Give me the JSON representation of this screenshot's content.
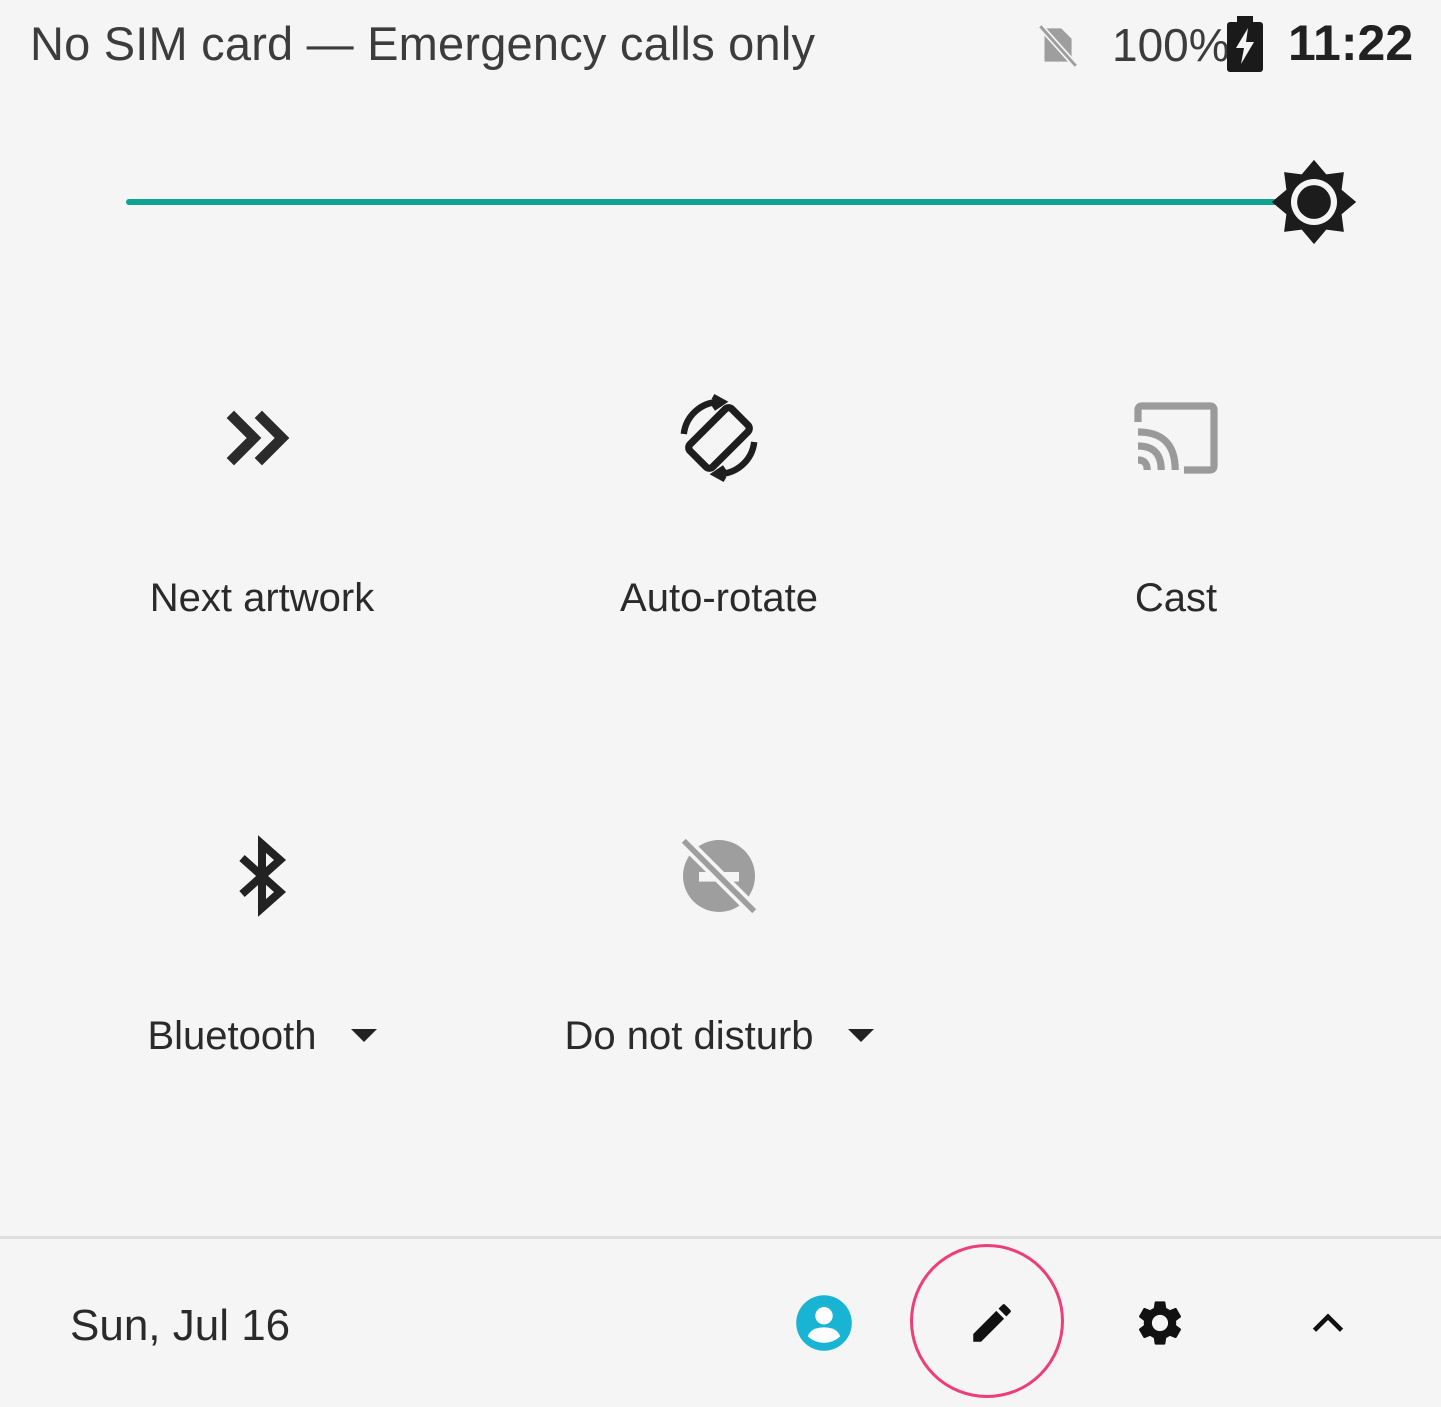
{
  "status_bar": {
    "carrier_text": "No SIM card — Emergency calls only",
    "battery_percent": "100%",
    "time": "11:22",
    "icons": [
      "no-sim-icon",
      "battery-charging-icon"
    ]
  },
  "brightness": {
    "level": 1.0,
    "track_color": "#0fa48f",
    "icon": "brightness-auto-icon"
  },
  "tiles": [
    {
      "label": "Next artwork",
      "icon": "double-chevron-right-icon",
      "has_dropdown": false,
      "state": "active"
    },
    {
      "label": "Auto-rotate",
      "icon": "screen-rotation-icon",
      "has_dropdown": false,
      "state": "active"
    },
    {
      "label": "Cast",
      "icon": "cast-icon",
      "has_dropdown": false,
      "state": "inactive"
    },
    {
      "label": "Bluetooth",
      "icon": "bluetooth-icon",
      "has_dropdown": true,
      "state": "active"
    },
    {
      "label": "Do not disturb",
      "icon": "do-not-disturb-off-icon",
      "has_dropdown": true,
      "state": "inactive"
    }
  ],
  "footer": {
    "date": "Sun, Jul 16",
    "buttons": [
      {
        "name": "user-icon",
        "color": "#19b4d4"
      },
      {
        "name": "edit-icon",
        "highlight_color": "#ee3e7a"
      },
      {
        "name": "settings-icon"
      },
      {
        "name": "collapse-chevron-up-icon"
      }
    ]
  }
}
